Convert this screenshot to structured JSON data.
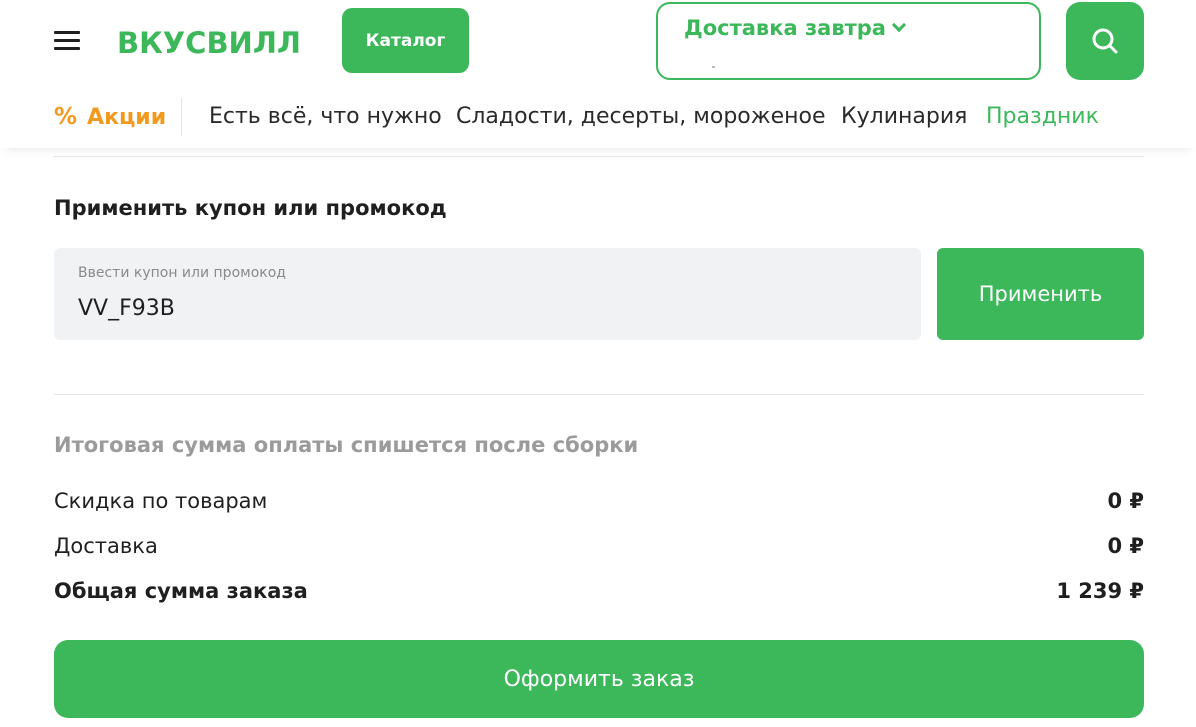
{
  "header": {
    "menu_icon": "hamburger-icon",
    "logo_text": "ВКУСВИЛЛ",
    "catalog_label": "Каталог",
    "delivery_label": "Доставка завтра",
    "search_icon": "search-icon",
    "brand_color": "#3cb85b"
  },
  "nav": {
    "promo_icon": "%",
    "promo_label": "Акции",
    "items": [
      "Есть всё, что нужно",
      "Сладости, десерты, мороженое",
      "Кулинария"
    ],
    "holiday_label": "Праздник",
    "promo_color": "#f39a1e"
  },
  "coupon": {
    "title": "Применить купон или промокод",
    "placeholder": "Ввести купон или промокод",
    "value": "VV_F93B",
    "apply_label": "Применить"
  },
  "summary": {
    "note": "Итоговая сумма оплаты спишется после сборки",
    "rows": [
      {
        "label": "Скидка по товарам",
        "value": "0 ₽"
      },
      {
        "label": "Доставка",
        "value": "0 ₽"
      },
      {
        "label": "Общая сумма заказа",
        "value": "1 239 ₽"
      }
    ]
  },
  "checkout": {
    "label": "Оформить заказ"
  }
}
